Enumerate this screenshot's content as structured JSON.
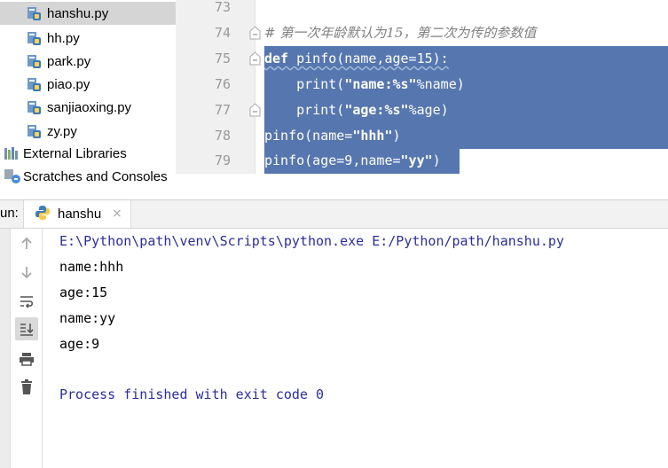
{
  "project_tree": {
    "files": [
      {
        "label": "hanshu.py",
        "selected": true
      },
      {
        "label": "hh.py",
        "selected": false
      },
      {
        "label": "park.py",
        "selected": false
      },
      {
        "label": "piao.py",
        "selected": false
      },
      {
        "label": "sanjiaoxing.py",
        "selected": false
      },
      {
        "label": "zy.py",
        "selected": false
      }
    ],
    "external_libraries": "External Libraries",
    "scratches": "Scratches and Consoles"
  },
  "editor": {
    "line_numbers": [
      "73",
      "74",
      "75",
      "76",
      "77",
      "78",
      "79"
    ],
    "comment": "# 第一次年龄默认为15，第二次为传的参数值",
    "line75": {
      "kw": "def",
      "rest": " pinfo(name,age=15):"
    },
    "line76": {
      "pre": "    print(",
      "str": "\"name:%s\"",
      "post": "%name)"
    },
    "line77": {
      "pre": "    print(",
      "str": "\"age:%s\"",
      "post": "%age)"
    },
    "line78": {
      "pre": "pinfo(name=",
      "str": "\"hhh\"",
      "post": ")"
    },
    "line79": {
      "pre": "pinfo(age=9,name=",
      "str": "\"yy\"",
      "post": ")"
    },
    "selection_color": "#5676af"
  },
  "run": {
    "label": "un:",
    "tab_label": "hanshu",
    "tab_close": "×",
    "console_lines": [
      "E:\\Python\\path\\venv\\Scripts\\python.exe E:/Python/path/hanshu.py",
      "name:hhh",
      "age:15",
      "name:yy",
      "age:9",
      "",
      "Process finished with exit code 0"
    ]
  },
  "icons": {
    "py_file": "python-file-icon",
    "libraries": "external-libraries-icon",
    "scratches": "scratches-icon",
    "up": "arrow-up-icon",
    "down": "arrow-down-icon",
    "wrap": "soft-wrap-icon",
    "scroll_end": "scroll-to-end-icon",
    "print": "print-icon",
    "trash": "trash-icon"
  }
}
